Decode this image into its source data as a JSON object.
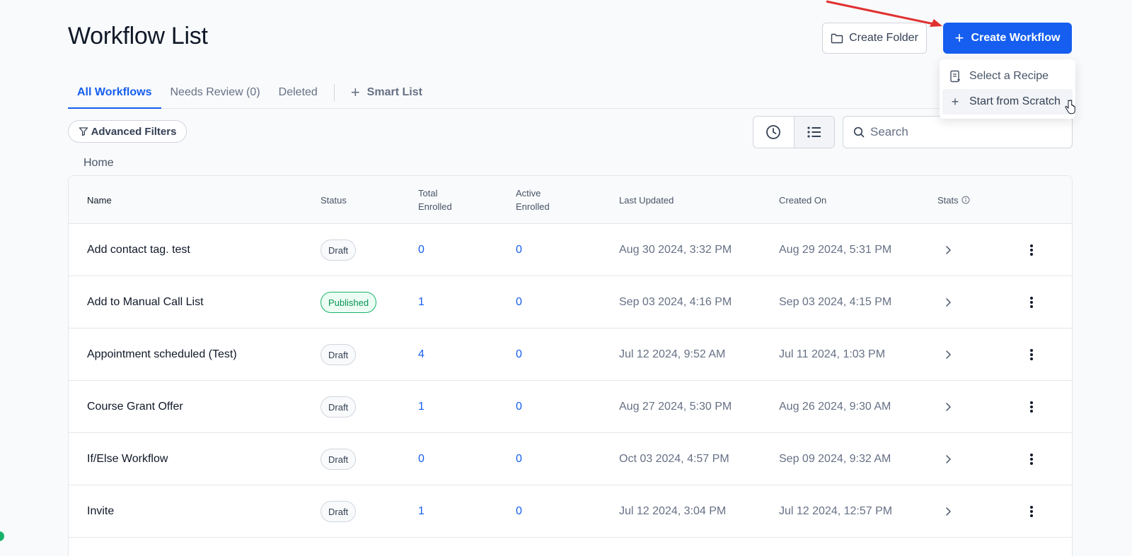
{
  "header": {
    "title": "Workflow List",
    "create_folder_label": "Create Folder",
    "create_workflow_label": "Create Workflow",
    "primary_color": "#155eef"
  },
  "dropdown": {
    "items": [
      {
        "label": "Select a Recipe",
        "icon": "recipe-icon"
      },
      {
        "label": "Start from Scratch",
        "icon": "plus-icon"
      }
    ]
  },
  "tabs": [
    {
      "label": "All Workflows",
      "active": true
    },
    {
      "label": "Needs Review (0)",
      "active": false
    },
    {
      "label": "Deleted",
      "active": false
    },
    {
      "label": "Smart List",
      "active": false
    }
  ],
  "filters": {
    "advanced_label": "Advanced Filters",
    "search_placeholder": "Search",
    "views": [
      "clock-icon",
      "list-icon"
    ]
  },
  "breadcrumb": "Home",
  "table": {
    "columns": {
      "name": "Name",
      "status": "Status",
      "total_line1": "Total",
      "total_line2": "Enrolled",
      "active_line1": "Active",
      "active_line2": "Enrolled",
      "updated": "Last Updated",
      "created": "Created On",
      "stats": "Stats"
    },
    "rows": [
      {
        "name": "Add contact tag. test",
        "status": "Draft",
        "total": "0",
        "active": "0",
        "updated": "Aug 30 2024, 3:32 PM",
        "created": "Aug 29 2024, 5:31 PM"
      },
      {
        "name": "Add to Manual Call List",
        "status": "Published",
        "total": "1",
        "active": "0",
        "updated": "Sep 03 2024, 4:16 PM",
        "created": "Sep 03 2024, 4:15 PM"
      },
      {
        "name": "Appointment scheduled (Test)",
        "status": "Draft",
        "total": "4",
        "active": "0",
        "updated": "Jul 12 2024, 9:52 AM",
        "created": "Jul 11 2024, 1:03 PM"
      },
      {
        "name": "Course Grant Offer",
        "status": "Draft",
        "total": "1",
        "active": "0",
        "updated": "Aug 27 2024, 5:30 PM",
        "created": "Aug 26 2024, 9:30 AM"
      },
      {
        "name": "If/Else Workflow",
        "status": "Draft",
        "total": "0",
        "active": "0",
        "updated": "Oct 03 2024, 4:57 PM",
        "created": "Sep 09 2024, 9:32 AM"
      },
      {
        "name": "Invite",
        "status": "Draft",
        "total": "1",
        "active": "0",
        "updated": "Jul 12 2024, 3:04 PM",
        "created": "Jul 12 2024, 12:57 PM"
      }
    ]
  }
}
